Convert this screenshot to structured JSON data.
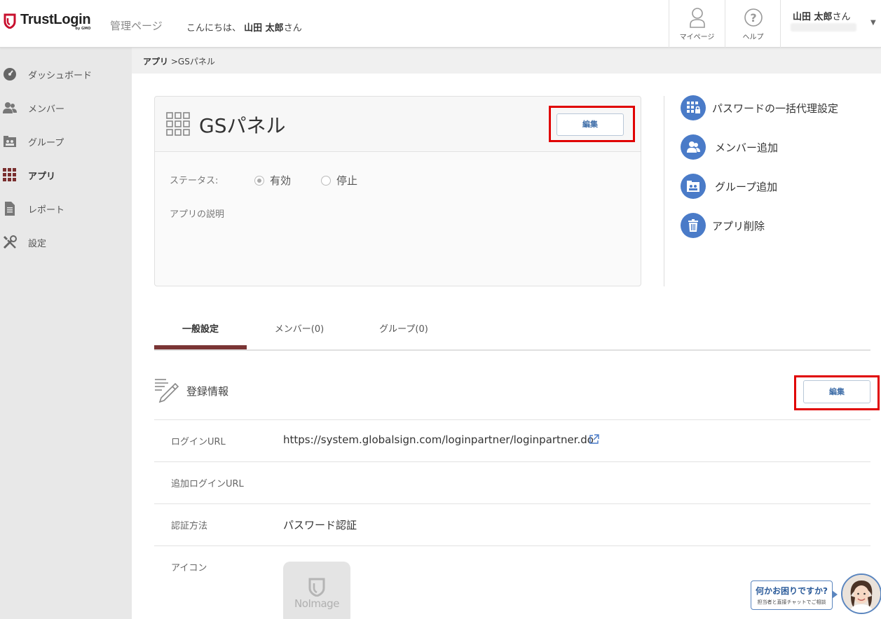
{
  "header": {
    "logo_text": "TrustLogin",
    "logo_sub": "by GMO",
    "admin_label": "管理ページ",
    "greeting_prefix": "こんにちは、",
    "greeting_name": "山田 太郎",
    "greeting_suffix": "さん",
    "mypage_label": "マイページ",
    "help_label": "ヘルプ",
    "user_name": "山田 太郎",
    "user_suffix": "さん"
  },
  "sidebar": {
    "items": [
      {
        "label": "ダッシュボード",
        "icon": "dashboard-icon"
      },
      {
        "label": "メンバー",
        "icon": "members-icon"
      },
      {
        "label": "グループ",
        "icon": "group-icon"
      },
      {
        "label": "アプリ",
        "icon": "apps-grid-icon",
        "active": true
      },
      {
        "label": "レポート",
        "icon": "report-icon"
      },
      {
        "label": "設定",
        "icon": "settings-tools-icon"
      }
    ]
  },
  "breadcrumb": {
    "parent": "アプリ",
    "separator": ">",
    "current": "GSパネル"
  },
  "app": {
    "title": "GSパネル",
    "edit_label": "編集",
    "status_label": "ステータス:",
    "status_options": [
      "有効",
      "停止"
    ],
    "status_selected": "有効",
    "description_label": "アプリの説明"
  },
  "actions": [
    {
      "label": "パスワードの一括代理設定",
      "icon": "bulk-password-icon"
    },
    {
      "label": "メンバー追加",
      "icon": "add-member-icon"
    },
    {
      "label": "グループ追加",
      "icon": "add-group-icon"
    },
    {
      "label": "アプリ削除",
      "icon": "trash-icon"
    }
  ],
  "tabs": [
    {
      "label": "一般設定",
      "active": true
    },
    {
      "label": "メンバー(0)"
    },
    {
      "label": "グループ(0)"
    }
  ],
  "registration": {
    "title": "登録情報",
    "edit_label": "編集",
    "rows": [
      {
        "key": "ログインURL",
        "value": "https://system.globalsign.com/loginpartner/loginpartner.do"
      },
      {
        "key": "追加ログインURL",
        "value": ""
      },
      {
        "key": "認証方法",
        "value": "パスワード認証"
      },
      {
        "key": "アイコン",
        "value": ""
      }
    ],
    "no_image_label": "NoImage"
  },
  "chat": {
    "title": "何かお困りですか?",
    "subtitle": "担当者と直接チャットでご相談"
  },
  "colors": {
    "accent_blue": "#4a7bc8",
    "tab_underline": "#7a3535",
    "highlight_red": "#e00000",
    "logo_red": "#c8102e"
  }
}
